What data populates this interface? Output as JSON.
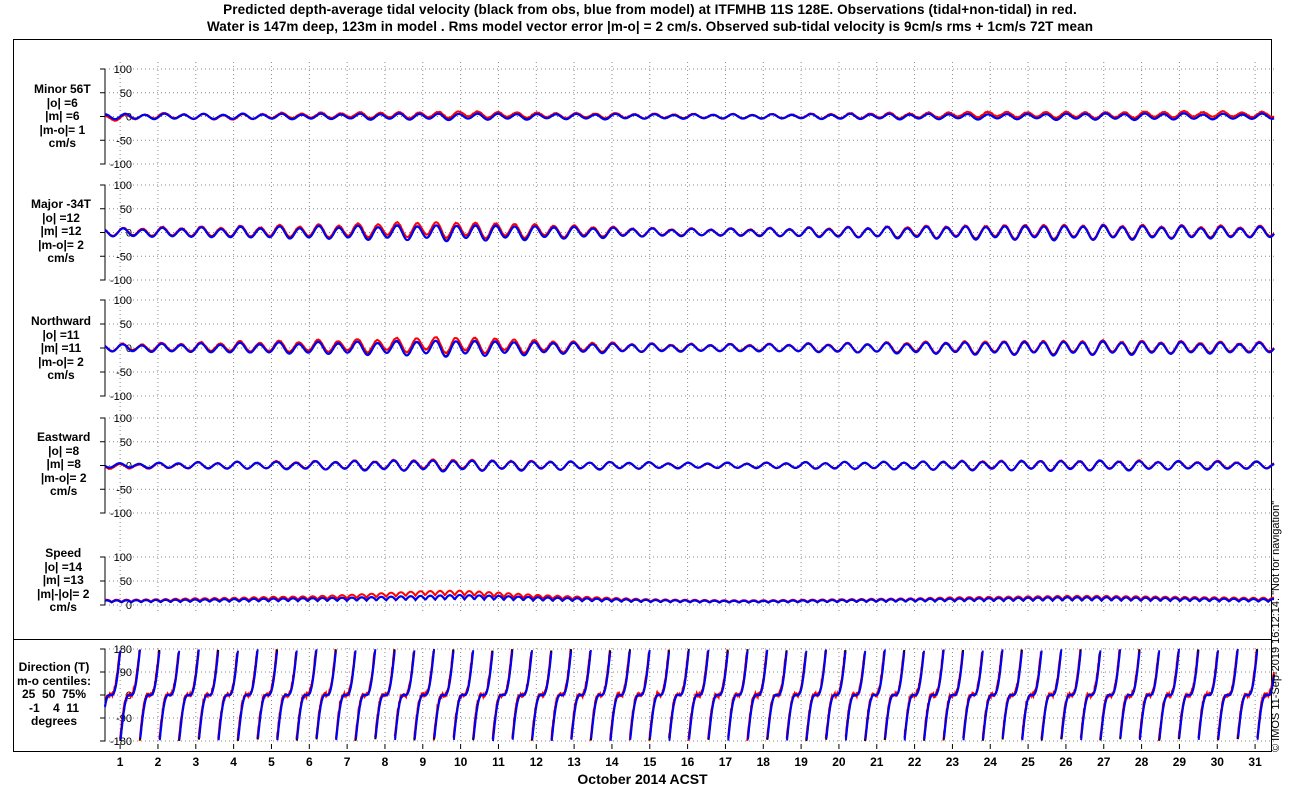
{
  "title": {
    "line1": "Predicted depth-average tidal velocity (black from obs, blue from model) at ITFMHB 11S 128E. Observations (tidal+non-tidal) in red.",
    "line2": "Water is 147m deep, 123m in model . Rms model vector error |m-o| = 2 cm/s. Observed sub-tidal velocity is 9cm/s rms + 1cm/s 72T mean"
  },
  "watermark": "© IMOS 11-Sep-2019 16:12:14.  \"Not for navigation\"",
  "x_axis": {
    "label": "October 2014 ACST",
    "ticks": [
      "1",
      "2",
      "3",
      "4",
      "5",
      "6",
      "7",
      "8",
      "9",
      "10",
      "11",
      "12",
      "13",
      "14",
      "15",
      "16",
      "17",
      "18",
      "19",
      "20",
      "21",
      "22",
      "23",
      "24",
      "25",
      "26",
      "27",
      "28",
      "29",
      "30",
      "31"
    ]
  },
  "colors": {
    "observed": "#ff0000",
    "obs_tidal": "#000000",
    "model": "#0000ff",
    "grid": "#888888"
  },
  "panel_labels": [
    [
      "Minor 56T",
      "|o| =6",
      "|m| =6",
      "|m-o|= 1",
      "cm/s"
    ],
    [
      "Major -34T",
      "|o| =12",
      "|m| =12",
      "|m-o|= 2",
      "cm/s"
    ],
    [
      "Northward",
      "|o| =11",
      "|m| =11",
      "|m-o|= 2",
      "cm/s"
    ],
    [
      "Eastward",
      "|o| =8",
      "|m| =8",
      "|m-o|= 2",
      "cm/s"
    ],
    [
      "Speed",
      "|o| =14",
      "|m| =13",
      "|m|-|o|= 2",
      "cm/s"
    ],
    [
      "Direction (T)",
      "m-o centiles:",
      "25  50  75%",
      "-1    4  11",
      "degrees"
    ]
  ],
  "chart_data": [
    {
      "type": "line",
      "name": "Minor 56T",
      "xlabel": "October 2014 ACST",
      "xlim": [
        0.6,
        31.5
      ],
      "ylim": [
        -100,
        100
      ],
      "yticks": [
        "100",
        "50",
        "0",
        "-50",
        "-100"
      ],
      "stats": {
        "obs_rms": 6,
        "model_rms": 6,
        "rms_error": 1,
        "unit": "cm/s"
      },
      "series_note": "observed red, obs-tidal black, model blue",
      "amplitude_by_day": [
        6,
        6,
        6,
        6,
        6,
        6,
        6,
        7,
        7,
        7,
        7,
        6,
        6,
        6,
        5,
        5,
        5,
        5,
        5,
        6,
        6,
        6,
        6,
        6,
        6,
        7,
        7,
        7,
        7,
        6,
        6
      ],
      "red_offset_by_day": [
        -3,
        2,
        0,
        -2,
        2,
        2,
        3,
        3,
        3,
        5,
        4,
        3,
        2,
        2,
        1,
        1,
        0,
        0,
        1,
        1,
        2,
        2,
        4,
        5,
        4,
        4,
        3,
        4,
        5,
        5,
        4
      ]
    },
    {
      "type": "line",
      "name": "Major -34T",
      "xlabel": "October 2014 ACST",
      "xlim": [
        0.6,
        31.5
      ],
      "ylim": [
        -100,
        100
      ],
      "yticks": [
        "100",
        "50",
        "0",
        "-50",
        "-100"
      ],
      "stats": {
        "obs_rms": 12,
        "model_rms": 12,
        "rms_error": 2,
        "unit": "cm/s"
      },
      "amplitude_by_day": [
        9,
        10,
        11,
        12,
        13,
        14,
        15,
        16,
        17,
        18,
        17,
        15,
        13,
        11,
        9,
        8,
        8,
        9,
        10,
        11,
        12,
        13,
        14,
        15,
        16,
        16,
        16,
        15,
        14,
        13,
        12
      ],
      "red_offset_by_day": [
        1,
        2,
        2,
        2,
        3,
        3,
        4,
        6,
        7,
        6,
        5,
        4,
        3,
        2,
        1,
        1,
        1,
        1,
        1,
        1,
        1,
        2,
        2,
        2,
        3,
        2,
        2,
        2,
        2,
        2,
        2
      ]
    },
    {
      "type": "line",
      "name": "Northward",
      "xlabel": "October 2014 ACST",
      "xlim": [
        0.6,
        31.5
      ],
      "ylim": [
        -100,
        100
      ],
      "yticks": [
        "100",
        "50",
        "0",
        "-50",
        "-100"
      ],
      "stats": {
        "obs_rms": 11,
        "model_rms": 11,
        "rms_error": 2,
        "unit": "cm/s"
      },
      "amplitude_by_day": [
        8,
        9,
        10,
        11,
        12,
        13,
        14,
        15,
        17,
        18,
        16,
        14,
        12,
        10,
        9,
        8,
        8,
        8,
        9,
        10,
        11,
        12,
        13,
        14,
        15,
        15,
        15,
        14,
        13,
        12,
        11
      ],
      "red_offset_by_day": [
        1,
        2,
        2,
        3,
        3,
        4,
        5,
        6,
        8,
        7,
        6,
        4,
        3,
        2,
        1,
        1,
        1,
        1,
        1,
        1,
        1,
        2,
        2,
        2,
        2,
        2,
        2,
        2,
        2,
        2,
        2
      ]
    },
    {
      "type": "line",
      "name": "Eastward",
      "xlabel": "October 2014 ACST",
      "xlim": [
        0.6,
        31.5
      ],
      "ylim": [
        -100,
        100
      ],
      "yticks": [
        "100",
        "50",
        "0",
        "-50",
        "-100"
      ],
      "stats": {
        "obs_rms": 8,
        "model_rms": 8,
        "rms_error": 2,
        "unit": "cm/s"
      },
      "amplitude_by_day": [
        5,
        6,
        7,
        8,
        8,
        9,
        10,
        11,
        12,
        12,
        11,
        10,
        9,
        8,
        7,
        6,
        6,
        6,
        7,
        8,
        8,
        9,
        10,
        10,
        11,
        11,
        11,
        10,
        9,
        9,
        8
      ],
      "red_offset_by_day": [
        -2,
        -1,
        0,
        0,
        1,
        1,
        1,
        1,
        2,
        2,
        1,
        1,
        0,
        0,
        0,
        0,
        0,
        0,
        0,
        0,
        0,
        0,
        1,
        1,
        1,
        1,
        1,
        1,
        1,
        1,
        1
      ]
    },
    {
      "type": "line",
      "name": "Speed",
      "xlabel": "October 2014 ACST",
      "xlim": [
        0.6,
        31.5
      ],
      "ylim": [
        0,
        100
      ],
      "yticks": [
        "100",
        "50",
        "0"
      ],
      "stats": {
        "obs_rms": 14,
        "model_rms": 13,
        "rms_error": 2,
        "unit": "cm/s"
      },
      "amplitude_by_day": [
        10,
        11,
        12,
        13,
        14,
        15,
        16,
        18,
        20,
        22,
        20,
        17,
        15,
        13,
        11,
        10,
        9,
        9,
        10,
        11,
        12,
        13,
        14,
        15,
        16,
        17,
        17,
        16,
        15,
        14,
        13
      ],
      "red_offset_by_day": [
        1,
        1,
        2,
        2,
        3,
        3,
        5,
        7,
        9,
        8,
        6,
        4,
        3,
        2,
        1,
        1,
        1,
        1,
        1,
        1,
        1,
        1,
        2,
        2,
        2,
        2,
        2,
        2,
        2,
        2,
        2
      ]
    },
    {
      "type": "line",
      "name": "Direction (T)",
      "xlabel": "October 2014 ACST",
      "xlim": [
        0.6,
        31.5
      ],
      "ylim": [
        -180,
        180
      ],
      "yticks": [
        "180",
        "90",
        "0",
        "-90",
        "-180"
      ],
      "stats": {
        "centile_25": -1,
        "centile_50": 4,
        "centile_75": 11,
        "unit": "degrees"
      },
      "series_note": "sawtooth wrapping between -180 and 180 roughly twice per day"
    }
  ]
}
